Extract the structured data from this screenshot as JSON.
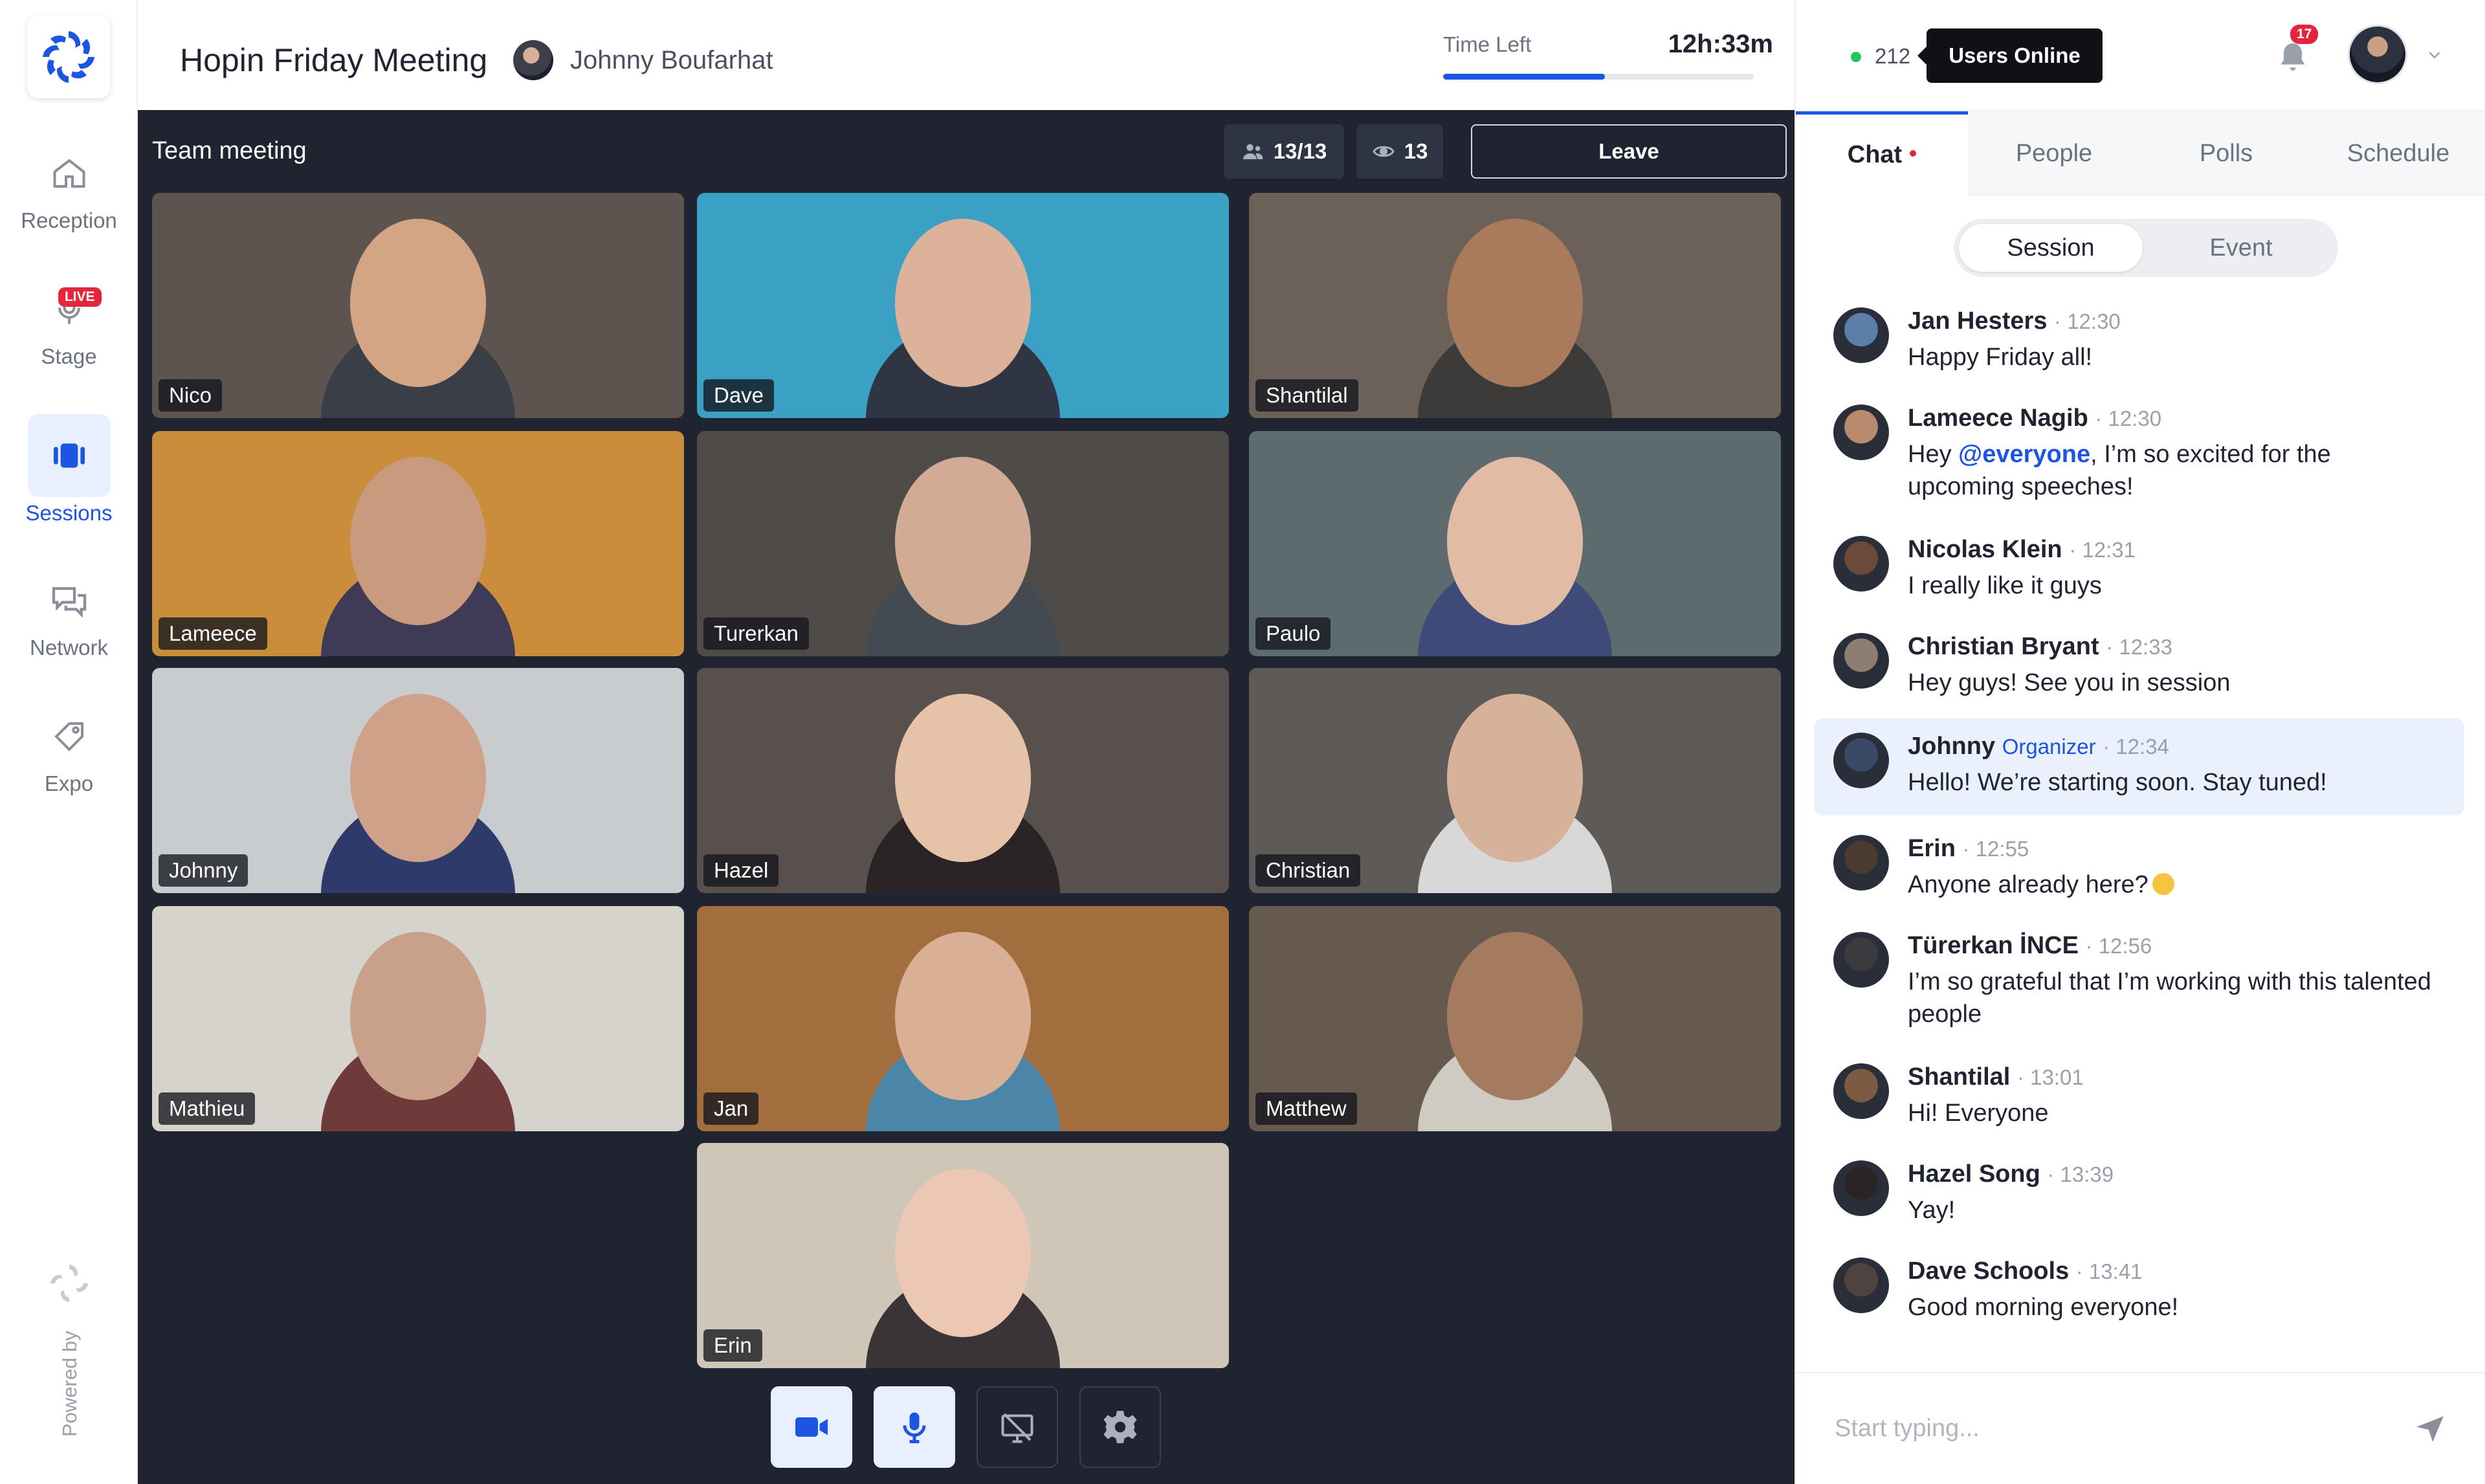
{
  "sidebar": {
    "items": [
      {
        "label": "Reception"
      },
      {
        "label": "Stage",
        "badge": "LIVE"
      },
      {
        "label": "Sessions"
      },
      {
        "label": "Network"
      },
      {
        "label": "Expo"
      }
    ],
    "powered_by": "Powered by"
  },
  "header": {
    "title": "Hopin Friday Meeting",
    "host": "Johnny Boufarhat",
    "time_label": "Time Left",
    "time_value": "12h:33m",
    "time_progress": 0.52
  },
  "stage": {
    "title": "Team meeting",
    "participants": "13/13",
    "viewers": "13",
    "leave_label": "Leave",
    "tiles": [
      {
        "name": "Nico",
        "bg": "#5d5450",
        "skin": "#d4a585",
        "shirt": "#3a3f47"
      },
      {
        "name": "Dave",
        "bg": "#3aa0c4",
        "skin": "#dcb39a",
        "shirt": "#2f3542"
      },
      {
        "name": "Shantilal",
        "bg": "#6b6158",
        "skin": "#a97a5c",
        "shirt": "#3d3b3a"
      },
      {
        "name": "Lameece",
        "bg": "#c98d3c",
        "skin": "#c99a7e",
        "shirt": "#3f3a55"
      },
      {
        "name": "Turerkan",
        "bg": "#4e4b49",
        "skin": "#d2ab94",
        "shirt": "#444a52"
      },
      {
        "name": "Paulo",
        "bg": "#5d6b6e",
        "skin": "#e2bba4",
        "shirt": "#3e4a78"
      },
      {
        "name": "Johnny",
        "bg": "#c9cccf",
        "skin": "#cfa189",
        "shirt": "#2e3a6a"
      },
      {
        "name": "Hazel",
        "bg": "#58504c",
        "skin": "#e6c2a9",
        "shirt": "#2a2426"
      },
      {
        "name": "Christian",
        "bg": "#5e5a58",
        "skin": "#d7b29b",
        "shirt": "#d8d8d8"
      },
      {
        "name": "Mathieu",
        "bg": "#d6d3cc",
        "skin": "#c9a089",
        "shirt": "#6e3b3a"
      },
      {
        "name": "Jan",
        "bg": "#a36e3d",
        "skin": "#d9b096",
        "shirt": "#4b85a8"
      },
      {
        "name": "Matthew",
        "bg": "#66594e",
        "skin": "#a47b5f",
        "shirt": "#cfcac2"
      },
      {
        "name": "Erin",
        "bg": "#cfc6b8",
        "skin": "#ecc8b4",
        "shirt": "#3a3436"
      }
    ]
  },
  "panel": {
    "online_count": "212",
    "online_label": "Users Online",
    "notifications": "17",
    "tabs": [
      {
        "label": "Chat"
      },
      {
        "label": "People"
      },
      {
        "label": "Polls"
      },
      {
        "label": "Schedule"
      }
    ],
    "segments": [
      {
        "label": "Session"
      },
      {
        "label": "Event"
      }
    ],
    "messages": [
      {
        "name": "Jan Hesters",
        "role": "",
        "time": "· 12:30",
        "text": "Happy Friday all!",
        "avatar": "#5b7fa6"
      },
      {
        "name": "Lameece Nagib",
        "role": "",
        "time": "· 12:30",
        "text_pre": "Hey ",
        "mention": "@everyone",
        "text_post": ", I’m so excited for the upcoming speeches!",
        "avatar": "#b98a6e"
      },
      {
        "name": "Nicolas Klein",
        "role": "",
        "time": "· 12:31",
        "text": "I really like it guys",
        "avatar": "#6b4a3a"
      },
      {
        "name": "Christian Bryant",
        "role": "",
        "time": "· 12:33",
        "text": "Hey guys! See you in session",
        "avatar": "#8d7d72"
      },
      {
        "name": "Johnny",
        "role": "Organizer",
        "time": "· 12:34",
        "text": "Hello! We’re starting soon. Stay tuned!",
        "avatar": "#3a4a66"
      },
      {
        "name": "Erin",
        "role": "",
        "time": "· 12:55",
        "text": "Anyone already here?",
        "emoji": "smile",
        "avatar": "#4a3a30"
      },
      {
        "name": "Türerkan İNCE",
        "role": "",
        "time": "· 12:56",
        "text": "I’m so grateful that I’m working with this talented people",
        "avatar": "#3b3a3e"
      },
      {
        "name": "Shantilal",
        "role": "",
        "time": "· 13:01",
        "text": "Hi! Everyone",
        "avatar": "#7d5a42"
      },
      {
        "name": "Hazel Song",
        "role": "",
        "time": "· 13:39",
        "text": "Yay!",
        "avatar": "#2b2426"
      },
      {
        "name": "Dave Schools",
        "role": "",
        "time": "· 13:41",
        "text": "Good morning everyone!",
        "avatar": "#4d4440"
      }
    ],
    "composer_placeholder": "Start typing..."
  }
}
